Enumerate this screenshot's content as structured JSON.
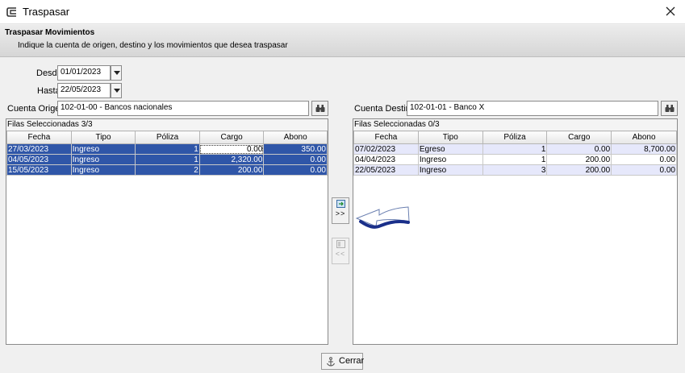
{
  "window": {
    "title": "Traspasar",
    "icon": "app-window-icon",
    "close_icon": "close-icon"
  },
  "header": {
    "title": "Traspasar Movimientos",
    "subtitle": "Indique la cuenta de origen, destino y los movimientos que desea traspasar"
  },
  "filters": {
    "desde_label": "Desde",
    "desde_value": "01/01/2023",
    "hasta_label": "Hasta",
    "hasta_value": "22/05/2023"
  },
  "origen": {
    "label": "Cuenta Origen",
    "value": "102-01-00 - Bancos nacionales",
    "selected_label": "Filas Seleccionadas",
    "selected_count": "3/3",
    "columns": [
      "Fecha",
      "Tipo",
      "Póliza",
      "Cargo",
      "Abono"
    ],
    "rows": [
      [
        "27/03/2023",
        "Ingreso",
        "1",
        "0.00",
        "350.00"
      ],
      [
        "04/05/2023",
        "Ingreso",
        "1",
        "2,320.00",
        "0.00"
      ],
      [
        "15/05/2023",
        "Ingreso",
        "2",
        "200.00",
        "0.00"
      ]
    ]
  },
  "destino": {
    "label": "Cuenta Destino",
    "value": "102-01-01 - Banco X",
    "selected_label": "Filas Seleccionadas",
    "selected_count": "0/3",
    "columns": [
      "Fecha",
      "Tipo",
      "Póliza",
      "Cargo",
      "Abono"
    ],
    "rows": [
      [
        "07/02/2023",
        "Egreso",
        "1",
        "0.00",
        "8,700.00"
      ],
      [
        "04/04/2023",
        "Ingreso",
        "1",
        "200.00",
        "0.00"
      ],
      [
        "22/05/2023",
        "Ingreso",
        "3",
        "200.00",
        "0.00"
      ]
    ]
  },
  "transfer": {
    "forward_label": ">>",
    "back_label": "<<"
  },
  "footer": {
    "close_label": "Cerrar"
  },
  "colors": {
    "selection": "#2f56a8",
    "arrow": "#1a2f8a"
  }
}
